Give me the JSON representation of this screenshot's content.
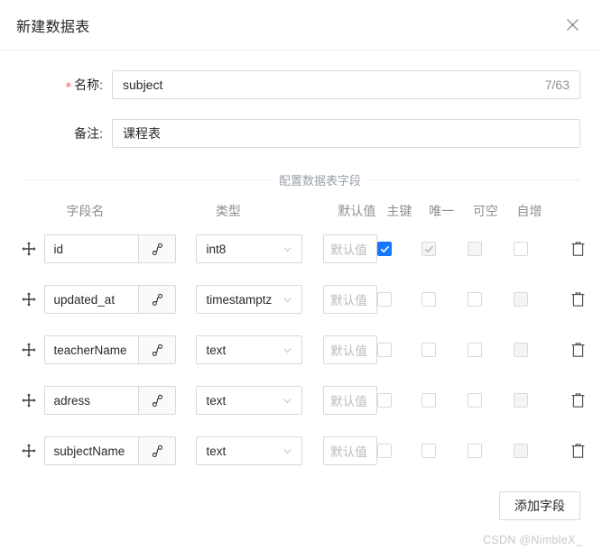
{
  "dialog": {
    "title": "新建数据表",
    "close_icon": "close-icon"
  },
  "form": {
    "name": {
      "required_mark": "*",
      "label": "名称:",
      "value": "subject",
      "counter": "7/63"
    },
    "remark": {
      "label": "备注:",
      "value": "课程表"
    }
  },
  "divider": {
    "label": "配置数据表字段"
  },
  "fields_table": {
    "headers": {
      "name": "字段名",
      "type": "类型",
      "default": "默认值",
      "primary_key": "主键",
      "unique": "唯一",
      "nullable": "可空",
      "auto_increment": "自增"
    },
    "default_placeholder": "默认值",
    "rows": [
      {
        "drag_icon": "drag-move-icon",
        "name": "id",
        "relation_icon": "relation-link-icon",
        "type": "int8",
        "default": "",
        "primary_key": {
          "checked": true,
          "disabled": false
        },
        "unique": {
          "checked": true,
          "disabled": true
        },
        "nullable": {
          "checked": false,
          "disabled": true
        },
        "auto_increment": {
          "checked": false,
          "disabled": false
        },
        "delete_icon": "trash-icon"
      },
      {
        "drag_icon": "drag-move-icon",
        "name": "updated_at",
        "relation_icon": "relation-link-icon",
        "type": "timestamptz",
        "default": "",
        "primary_key": {
          "checked": false,
          "disabled": false
        },
        "unique": {
          "checked": false,
          "disabled": false
        },
        "nullable": {
          "checked": false,
          "disabled": false
        },
        "auto_increment": {
          "checked": false,
          "disabled": true
        },
        "delete_icon": "trash-icon"
      },
      {
        "drag_icon": "drag-move-icon",
        "name": "teacherName",
        "relation_icon": "relation-link-icon",
        "type": "text",
        "default": "",
        "primary_key": {
          "checked": false,
          "disabled": false
        },
        "unique": {
          "checked": false,
          "disabled": false
        },
        "nullable": {
          "checked": false,
          "disabled": false
        },
        "auto_increment": {
          "checked": false,
          "disabled": true
        },
        "delete_icon": "trash-icon"
      },
      {
        "drag_icon": "drag-move-icon",
        "name": "adress",
        "relation_icon": "relation-link-icon",
        "type": "text",
        "default": "",
        "primary_key": {
          "checked": false,
          "disabled": false
        },
        "unique": {
          "checked": false,
          "disabled": false
        },
        "nullable": {
          "checked": false,
          "disabled": false
        },
        "auto_increment": {
          "checked": false,
          "disabled": true
        },
        "delete_icon": "trash-icon"
      },
      {
        "drag_icon": "drag-move-icon",
        "name": "subjectName",
        "relation_icon": "relation-link-icon",
        "type": "text",
        "default": "",
        "primary_key": {
          "checked": false,
          "disabled": false
        },
        "unique": {
          "checked": false,
          "disabled": false
        },
        "nullable": {
          "checked": false,
          "disabled": false
        },
        "auto_increment": {
          "checked": false,
          "disabled": true
        },
        "delete_icon": "trash-icon"
      }
    ]
  },
  "actions": {
    "add_field_label": "添加字段"
  },
  "watermark": {
    "text": "CSDN @NimbleX_"
  },
  "colors": {
    "accent": "#1677ff",
    "required": "#ff4d4f",
    "border": "#d9d9d9",
    "muted_text": "#9aa0ab"
  }
}
